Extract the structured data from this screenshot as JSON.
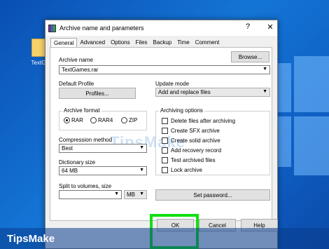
{
  "desktop": {
    "icon_label": "TextG"
  },
  "dialog": {
    "title": "Archive name and parameters",
    "help_label": "?",
    "close_label": "✕",
    "tabs": [
      "General",
      "Advanced",
      "Options",
      "Files",
      "Backup",
      "Time",
      "Comment"
    ],
    "active_tab": "General",
    "archive_name_label": "Archive name",
    "archive_name_value": "TextGames.rar",
    "browse_label": "Browse...",
    "default_profile_label": "Default Profile",
    "profiles_label": "Profiles...",
    "update_mode_label": "Update mode",
    "update_mode_value": "Add and replace files",
    "archive_format_label": "Archive format",
    "formats": [
      "RAR",
      "RAR4",
      "ZIP"
    ],
    "selected_format": "RAR",
    "compression_method_label": "Compression method",
    "compression_method_value": "Best",
    "dictionary_size_label": "Dictionary size",
    "dictionary_size_value": "64 MB",
    "split_label": "Split to volumes, size",
    "split_value": "",
    "split_unit": "MB",
    "archiving_options_label": "Archiving options",
    "options": [
      "Delete files after archiving",
      "Create SFX archive",
      "Create solid archive",
      "Add recovery record",
      "Test archived files",
      "Lock archive"
    ],
    "set_password_label": "Set password...",
    "ok_label": "OK",
    "cancel_label": "Cancel",
    "help_button_label": "Help",
    "watermark": "TipsMake"
  },
  "brand": {
    "name": "TipsMake"
  },
  "colors": {
    "highlight": "#12e012",
    "desktop": "#1475d6"
  }
}
